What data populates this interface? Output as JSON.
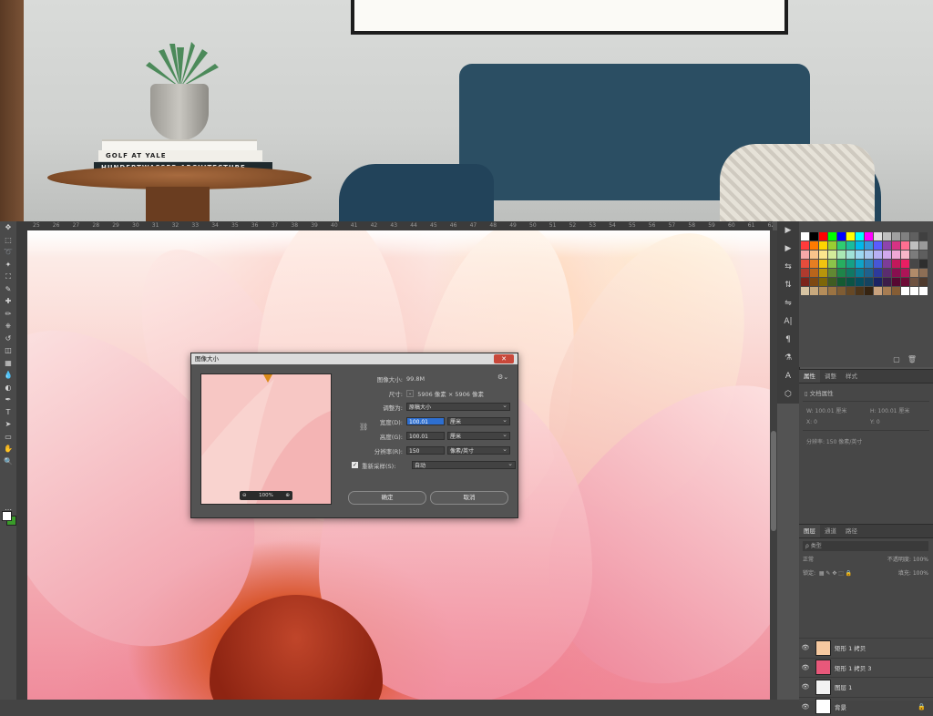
{
  "room_photo": {
    "books": [
      "HUNDERTWASSER ARCHITECTURE",
      "GOLF AT YALE",
      ""
    ]
  },
  "ruler": {
    "ticks": [
      "25",
      "26",
      "27",
      "28",
      "29",
      "30",
      "31",
      "32",
      "33",
      "34",
      "35",
      "36",
      "37",
      "38",
      "39",
      "40",
      "41",
      "42",
      "43",
      "44",
      "45",
      "46",
      "47",
      "48",
      "49",
      "50",
      "51",
      "52",
      "53",
      "54",
      "55",
      "56",
      "57",
      "58",
      "59",
      "60",
      "61",
      "62"
    ]
  },
  "toolbar": {
    "tools": [
      "move-icon",
      "marquee-icon",
      "lasso-icon",
      "magic-wand-icon",
      "crop-icon",
      "eyedropper-icon",
      "healing-icon",
      "brush-icon",
      "stamp-icon",
      "history-brush-icon",
      "eraser-icon",
      "gradient-icon",
      "blur-icon",
      "dodge-icon",
      "pen-icon",
      "type-icon",
      "path-select-icon",
      "rectangle-icon",
      "hand-icon",
      "zoom-icon",
      "more-icon"
    ],
    "tool_glyphs": [
      "✥",
      "⬚",
      "➰",
      "✦",
      "⛶",
      "✎",
      "✚",
      "✏",
      "⎈",
      "↺",
      "◫",
      "▦",
      "💧",
      "◐",
      "✒",
      "T",
      "➤",
      "▭",
      "✋",
      "🔍",
      "⋯"
    ],
    "foreground_color": "#ffffff",
    "background_color": "#3a9a2a"
  },
  "icon_strip": {
    "glyphs": [
      "▶",
      "▶",
      "⇆",
      "⇅",
      "⇋",
      "A|",
      "¶",
      "⚗",
      "A",
      "⬡"
    ]
  },
  "swatches": {
    "colors": [
      "#ffffff",
      "#000000",
      "#ff0000",
      "#00ff00",
      "#0000ff",
      "#ffff00",
      "#00ffff",
      "#ff00ff",
      "#e0e0e0",
      "#c0c0c0",
      "#a0a0a0",
      "#808080",
      "#606060",
      "#404040",
      "#ff3b3b",
      "#ff7a00",
      "#ffd400",
      "#9acd32",
      "#2ecc71",
      "#1abc9c",
      "#00b7eb",
      "#3498db",
      "#5b5bff",
      "#8e44ad",
      "#d63384",
      "#ff6f91",
      "#bfbfbf",
      "#9a9a9a",
      "#f7a8a8",
      "#f9c48b",
      "#fbe58d",
      "#d3ec9a",
      "#a9e8b4",
      "#9fe2d8",
      "#9bd8f2",
      "#a9c8f0",
      "#b8b0f5",
      "#d1a8ec",
      "#f0a8d4",
      "#f7b6c8",
      "#7c7c7c",
      "#5e5e5e",
      "#e74c3c",
      "#e67e22",
      "#f1c40f",
      "#8bc34a",
      "#27ae60",
      "#16a085",
      "#0fa3c8",
      "#2980b9",
      "#4757d6",
      "#7d3c98",
      "#c2185b",
      "#e91e63",
      "#474747",
      "#2e2e2e",
      "#b03a2e",
      "#b9651b",
      "#b7950b",
      "#618833",
      "#1e8449",
      "#117864",
      "#0b7a94",
      "#1f618d",
      "#2d3a9c",
      "#5b2c6f",
      "#880e4f",
      "#ad1457",
      "#b08b6a",
      "#8d6e55",
      "#7b241c",
      "#7e4812",
      "#7d6608",
      "#3f5c22",
      "#145a32",
      "#0b5345",
      "#074f60",
      "#154360",
      "#1b2363",
      "#3b1d49",
      "#560831",
      "#6d0c36",
      "#6e5240",
      "#4e3a2d",
      "#d7c4a3",
      "#c8a97e",
      "#b58d5a",
      "#9b7342",
      "#7f5c33",
      "#664825",
      "#4d351a",
      "#362411",
      "#c9a27e",
      "#a67c52",
      "#855d35",
      "#ffffff",
      "#ffffff",
      "#ffffff"
    ]
  },
  "properties": {
    "tabs": [
      "属性",
      "调整",
      "样式"
    ],
    "doc_label": "文档属性",
    "w_label": "W:",
    "w_value": "100.01 厘米",
    "h_label": "H:",
    "h_value": "100.01 厘米",
    "x_label": "X:",
    "x_value": "0",
    "y_label": "Y:",
    "y_value": "0",
    "resolution_text": "分辨率: 150 像素/英寸"
  },
  "layers_panel": {
    "tabs": [
      "图层",
      "通道",
      "路径"
    ],
    "filter_label": "ρ 类型",
    "blend_mode": "正常",
    "opacity_label": "不透明度: 100%",
    "lock_label": "锁定:",
    "fill_label": "填充: 100%",
    "layers": [
      {
        "name": "矩形 1 拷贝",
        "color": "#f6c9a0",
        "locked": false
      },
      {
        "name": "矩形 1 拷贝 3",
        "color": "#e8587a",
        "locked": false
      },
      {
        "name": "图层 1",
        "color": "#f3f3f3",
        "locked": false
      },
      {
        "name": "背景",
        "color": "#ffffff",
        "locked": true
      }
    ]
  },
  "dialog": {
    "title": "图像大小",
    "close_glyph": "✕",
    "zoom_label": "100%",
    "image_size_label": "图像大小:",
    "image_size_value": "99.8M",
    "dimensions_label": "尺寸:",
    "dimensions_value": "5906 像素 × 5906 像素",
    "fit_label": "调整为:",
    "fit_value": "原稿大小",
    "width_label": "宽度(D):",
    "width_value": "100.01",
    "width_unit": "厘米",
    "height_label": "高度(G):",
    "height_value": "100.01",
    "height_unit": "厘米",
    "resolution_label": "分辨率(R):",
    "resolution_value": "150",
    "resolution_unit": "像素/英寸",
    "resample_label": "重新采样(S):",
    "resample_value": "自动",
    "ok_label": "确定",
    "cancel_label": "取消"
  }
}
